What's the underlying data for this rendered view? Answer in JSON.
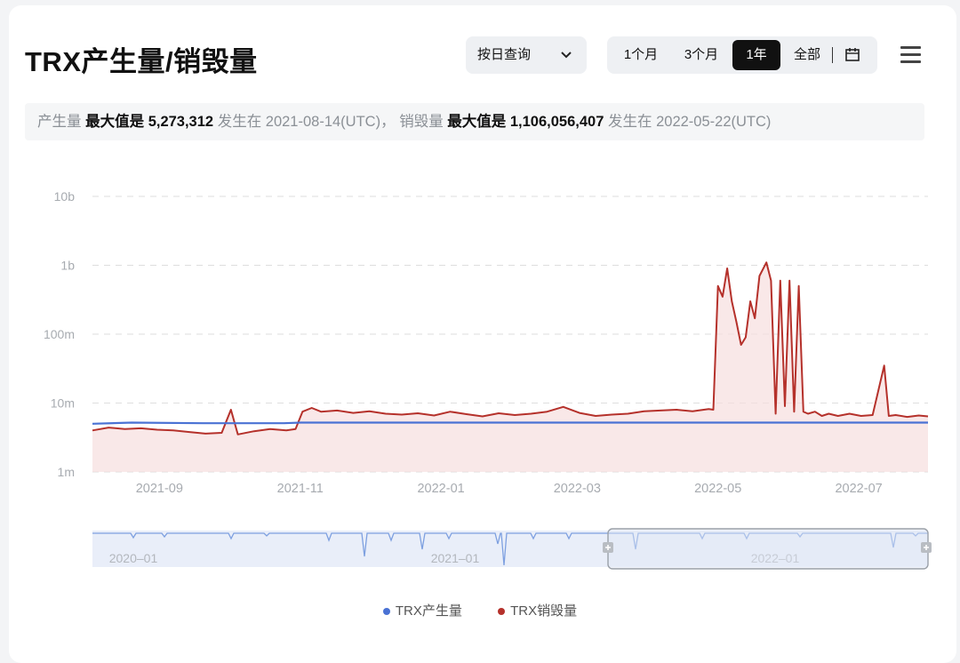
{
  "title": "TRX产生量/销毁量",
  "controls": {
    "query_mode": "按日查询",
    "ranges": [
      "1个月",
      "3个月",
      "1年",
      "全部"
    ],
    "active_range": "1年"
  },
  "stats": {
    "mint_label": "产生量",
    "mint_max_label": "最大值是",
    "mint_max_value": "5,273,312",
    "mint_on": "发生在",
    "mint_date": "2021-08-14(UTC)，",
    "burn_label": "销毁量",
    "burn_max_label": "最大值是",
    "burn_max_value": "1,106,056,407",
    "burn_on": "发生在",
    "burn_date": "2022-05-22(UTC)"
  },
  "colors": {
    "mint": "#4a72d4",
    "burn": "#b5312b",
    "burn_area": "#f7dede",
    "grid": "#dedede",
    "axis_text": "#a7abb0",
    "navigator_fill": "#e9eef9"
  },
  "legend": [
    {
      "name": "TRX产生量",
      "color": "#4a72d4"
    },
    {
      "name": "TRX销毁量",
      "color": "#b5312b"
    }
  ],
  "chart_data": {
    "type": "line",
    "yscale": "log",
    "ylim": [
      1000000,
      10000000000
    ],
    "ytick_values": [
      1000000,
      10000000,
      100000000,
      1000000000,
      10000000000
    ],
    "yticks": [
      "1m",
      "10m",
      "100m",
      "1b",
      "10b"
    ],
    "xlim": [
      "2021-08-03",
      "2022-07-31"
    ],
    "xtick_values": [
      "2021-09-01",
      "2021-11-01",
      "2022-01-01",
      "2022-03-01",
      "2022-05-01",
      "2022-07-01"
    ],
    "xticks": [
      "2021-09",
      "2021-11",
      "2022-01",
      "2022-03",
      "2022-05",
      "2022-07"
    ],
    "grid": true,
    "legend_position": "bottom-center",
    "series": [
      {
        "name": "TRX产生量",
        "x": [
          "2021-08-03",
          "2021-08-20",
          "2021-09-20",
          "2021-10-25",
          "2021-11-01",
          "2021-12-15",
          "2022-02-01",
          "2022-04-01",
          "2022-06-01",
          "2022-07-31"
        ],
        "values": [
          5000000,
          5200000,
          5100000,
          5100000,
          5200000,
          5200000,
          5200000,
          5200000,
          5200000,
          5200000
        ]
      },
      {
        "name": "TRX销毁量",
        "x": [
          "2021-08-03",
          "2021-08-10",
          "2021-08-17",
          "2021-08-24",
          "2021-08-31",
          "2021-09-07",
          "2021-09-14",
          "2021-09-21",
          "2021-09-28",
          "2021-10-02",
          "2021-10-05",
          "2021-10-12",
          "2021-10-19",
          "2021-10-26",
          "2021-10-30",
          "2021-11-02",
          "2021-11-06",
          "2021-11-10",
          "2021-11-17",
          "2021-11-24",
          "2021-12-01",
          "2021-12-08",
          "2021-12-15",
          "2021-12-22",
          "2021-12-29",
          "2022-01-05",
          "2022-01-12",
          "2022-01-19",
          "2022-01-26",
          "2022-02-02",
          "2022-02-09",
          "2022-02-16",
          "2022-02-23",
          "2022-03-02",
          "2022-03-09",
          "2022-03-16",
          "2022-03-23",
          "2022-03-30",
          "2022-04-06",
          "2022-04-13",
          "2022-04-20",
          "2022-04-27",
          "2022-04-29",
          "2022-05-01",
          "2022-05-03",
          "2022-05-05",
          "2022-05-07",
          "2022-05-09",
          "2022-05-11",
          "2022-05-13",
          "2022-05-15",
          "2022-05-17",
          "2022-05-19",
          "2022-05-22",
          "2022-05-24",
          "2022-05-26",
          "2022-05-28",
          "2022-05-30",
          "2022-06-01",
          "2022-06-03",
          "2022-06-05",
          "2022-06-07",
          "2022-06-09",
          "2022-06-12",
          "2022-06-15",
          "2022-06-18",
          "2022-06-22",
          "2022-06-27",
          "2022-07-02",
          "2022-07-07",
          "2022-07-12",
          "2022-07-14",
          "2022-07-17",
          "2022-07-22",
          "2022-07-27",
          "2022-07-31"
        ],
        "values": [
          4000000,
          4400000,
          4200000,
          4300000,
          4100000,
          4000000,
          3800000,
          3600000,
          3700000,
          8000000,
          3500000,
          3900000,
          4200000,
          4000000,
          4200000,
          7500000,
          8500000,
          7500000,
          7800000,
          7200000,
          7600000,
          7000000,
          6800000,
          7100000,
          6600000,
          7500000,
          6900000,
          6400000,
          7100000,
          6700000,
          7000000,
          7500000,
          8800000,
          7200000,
          6500000,
          6800000,
          7000000,
          7600000,
          7800000,
          8000000,
          7600000,
          8200000,
          8000000,
          500000000,
          350000000,
          900000000,
          300000000,
          150000000,
          70000000,
          90000000,
          300000000,
          170000000,
          700000000,
          1100000000,
          600000000,
          7000000,
          600000000,
          9000000,
          600000000,
          7500000,
          500000000,
          7500000,
          7000000,
          7500000,
          6500000,
          7000000,
          6500000,
          7000000,
          6500000,
          6700000,
          35000000,
          6500000,
          6700000,
          6300000,
          6600000,
          6400000
        ]
      }
    ],
    "navigator": {
      "xlabels": [
        "2020–01",
        "2021–01",
        "2022–01"
      ],
      "window": [
        "2021-08-03",
        "2022-07-31"
      ]
    }
  }
}
